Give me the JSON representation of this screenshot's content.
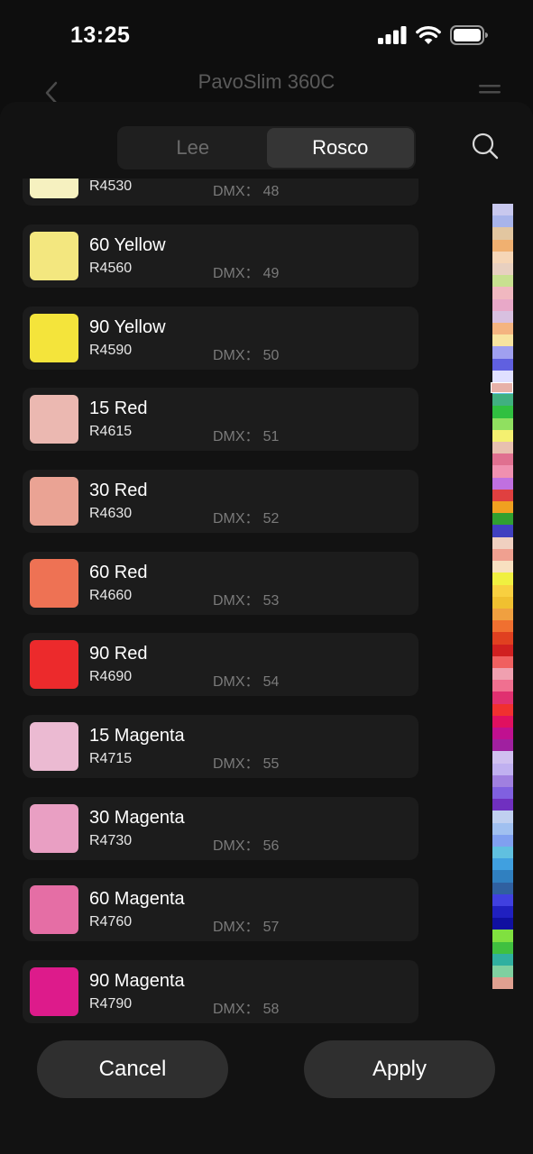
{
  "status": {
    "time": "13:25"
  },
  "background": {
    "title": "PavoSlim 360C",
    "subtitle": ""
  },
  "tabs": [
    {
      "label": "Lee",
      "active": false
    },
    {
      "label": "Rosco",
      "active": true
    }
  ],
  "dmx_label": "DMX：",
  "items": [
    {
      "name": "",
      "code": "R4530",
      "dmx": "48",
      "color": "#f6f1c0"
    },
    {
      "name": "60 Yellow",
      "code": "R4560",
      "dmx": "49",
      "color": "#f3e77f"
    },
    {
      "name": "90 Yellow",
      "code": "R4590",
      "dmx": "50",
      "color": "#f4e43b"
    },
    {
      "name": "15 Red",
      "code": "R4615",
      "dmx": "51",
      "color": "#ebb8b1"
    },
    {
      "name": "30 Red",
      "code": "R4630",
      "dmx": "52",
      "color": "#eaa394"
    },
    {
      "name": "60 Red",
      "code": "R4660",
      "dmx": "53",
      "color": "#ee7254"
    },
    {
      "name": "90 Red",
      "code": "R4690",
      "dmx": "54",
      "color": "#ec2a2c"
    },
    {
      "name": "15 Magenta",
      "code": "R4715",
      "dmx": "55",
      "color": "#ebbad2"
    },
    {
      "name": "30 Magenta",
      "code": "R4730",
      "dmx": "56",
      "color": "#e99fc3"
    },
    {
      "name": "60 Magenta",
      "code": "R4760",
      "dmx": "57",
      "color": "#e56ea5"
    },
    {
      "name": "90 Magenta",
      "code": "R4790",
      "dmx": "58",
      "color": "#dd1b8b"
    }
  ],
  "strip_colors": [
    "#c8c8ee",
    "#a8b4ea",
    "#e2c6a0",
    "#f0b070",
    "#f6d6b6",
    "#e8d0c0",
    "#c8e090",
    "#f0b8c0",
    "#e8a8c8",
    "#d8c0e0",
    "#f4b480",
    "#f8e4a0",
    "#a0a0f0",
    "#6060e0",
    "#e0e0ff",
    "#60c0e0",
    "#40b080",
    "#30c040",
    "#90e060",
    "#f4f070",
    "#e8c0b0",
    "#e07090",
    "#f090b0",
    "#c070e0",
    "#e04040",
    "#f0a020",
    "#30a030",
    "#4040c0",
    "#f0d0c0",
    "#f0a090",
    "#f8e0c0",
    "#f0f040",
    "#f8d040",
    "#f0c030",
    "#f0a040",
    "#f07030",
    "#e04020",
    "#d02020",
    "#f06060",
    "#f0a0b0",
    "#f07090",
    "#e03070",
    "#f03030",
    "#e01060",
    "#c01090",
    "#a020a0",
    "#d0c0f0",
    "#c0b0f0",
    "#a080e0",
    "#8060e0",
    "#7030c0",
    "#c0d0f0",
    "#a0c0f0",
    "#80a0f0",
    "#60c0e0",
    "#40a0e0",
    "#3080c0",
    "#3060a0",
    "#4040e0",
    "#2020c0",
    "#1010a0",
    "#80e040",
    "#40c040",
    "#30b0a0",
    "#80d0a0",
    "#e0a090"
  ],
  "buttons": {
    "cancel": "Cancel",
    "apply": "Apply"
  }
}
